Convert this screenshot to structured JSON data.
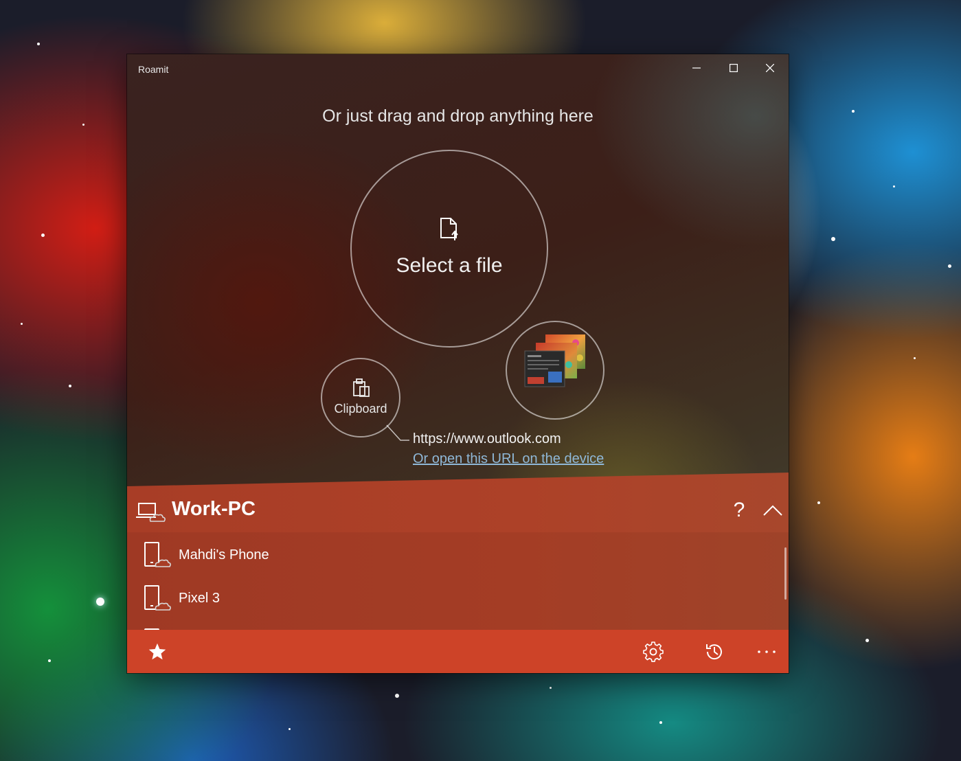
{
  "window": {
    "title": "Roamit"
  },
  "drop_area": {
    "hint": "Or just drag and drop anything here",
    "select_file_label": "Select a file",
    "clipboard_label": "Clipboard",
    "clipboard_url": "https://www.outlook.com",
    "open_url_link": "Or open this URL on the device"
  },
  "device_panel": {
    "current_device": "Work-PC",
    "help_label": "?",
    "devices": [
      {
        "name": "Mahdi's Phone",
        "icon": "phone-cloud-icon"
      },
      {
        "name": "Pixel 3",
        "icon": "phone-cloud-icon"
      }
    ]
  },
  "command_bar": {
    "buttons": [
      "star-icon",
      "gear-icon",
      "history-icon",
      "more-icon"
    ]
  },
  "colors": {
    "accent": "#cd4328",
    "panel": "#a93f26",
    "link": "#8fb8d8"
  }
}
